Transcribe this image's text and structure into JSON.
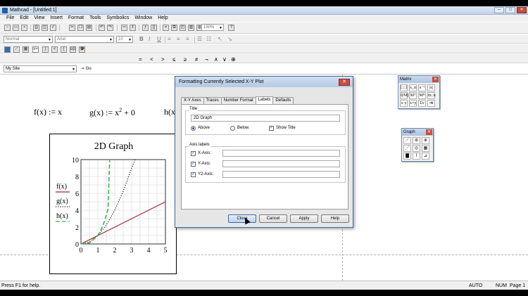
{
  "window": {
    "title": "Mathcad - [Untitled:1]"
  },
  "menu": [
    "File",
    "Edit",
    "View",
    "Insert",
    "Format",
    "Tools",
    "Symbolics",
    "Window",
    "Help"
  ],
  "toolbar": {
    "zoom": "150%",
    "style": "Normal",
    "font": "Arial",
    "font_size": "10",
    "bold": "B",
    "italic": "I",
    "underline": "U",
    "operators": [
      "=",
      "<",
      ">",
      "≤",
      "≥",
      "≠",
      "¬",
      "∧",
      "∨",
      "⊕"
    ]
  },
  "resource_bar": {
    "site": "My Site",
    "go_label": "Go"
  },
  "worksheet": {
    "f_def": "f(x) := x",
    "g_def_base": "g(x) := x",
    "g_def_exp": "2",
    "g_def_tail": " + 0",
    "h_def": "h(x"
  },
  "chart_data": {
    "type": "line",
    "title": "2D Graph",
    "xlim": [
      0,
      5
    ],
    "ylim": [
      0,
      10
    ],
    "x_ticks": [
      "0",
      "1",
      "2",
      "3",
      "4",
      "5"
    ],
    "y_ticks": [
      "0",
      "2",
      "4",
      "6",
      "8",
      "10"
    ],
    "legend": [
      "f(x)",
      "g(x)",
      "h(x)"
    ],
    "grid": true,
    "series": [
      {
        "name": "f(x)",
        "color": "#a8202a",
        "style": "solid",
        "x": [
          0,
          5
        ],
        "y": [
          0,
          5
        ]
      },
      {
        "name": "g(x)",
        "color": "#1a1a1a",
        "style": "dotted",
        "x": [
          0,
          0.5,
          1,
          1.5,
          2,
          2.5,
          3,
          3.2
        ],
        "y": [
          0,
          0.25,
          1,
          2.25,
          4,
          6.25,
          9,
          10.24
        ]
      },
      {
        "name": "h(x)",
        "color": "#3ab54a",
        "style": "dashed",
        "x": [
          0,
          0.5,
          1,
          1.2,
          1.4,
          1.6,
          1.7
        ],
        "y": [
          0,
          0.125,
          1,
          1.73,
          2.74,
          4.1,
          10
        ]
      }
    ]
  },
  "matrix_palette": {
    "title": "Matrix",
    "buttons": [
      "[:::]",
      "x_n",
      "x⁻¹",
      "|x|",
      "f(M)",
      "Mᵀ",
      "Mᴴ",
      "m..n",
      "x·y",
      "x×y",
      "Σv",
      "⇉"
    ]
  },
  "graph_palette": {
    "title": "Graph",
    "buttons": [
      "⟋",
      "⊛",
      "⊕",
      "⋰",
      "◎",
      "▦",
      "▇",
      "⌇",
      "⊿"
    ]
  },
  "dialog": {
    "title": "Formatting Currently Selected X-Y Plot",
    "close": "✕",
    "tabs": [
      "X-Y Axes",
      "Traces",
      "Number Format",
      "Labels",
      "Defaults"
    ],
    "active_tab": "Labels",
    "title_group": "Title",
    "title_value": "2D Graph",
    "above": "Above",
    "below": "Below",
    "show_title": "Show Title",
    "axis_group": "Axis labels",
    "x_axis": "X-Axis:",
    "y_axis": "Y-Axis:",
    "y2_axis": "Y2-Axis:",
    "buttons": {
      "close": "Close",
      "cancel": "Cancel",
      "apply": "Apply",
      "help": "Help"
    }
  },
  "status": {
    "help": "Press F1 for help.",
    "mode": "AUTO",
    "num": "NUM",
    "page": "Page 1"
  }
}
